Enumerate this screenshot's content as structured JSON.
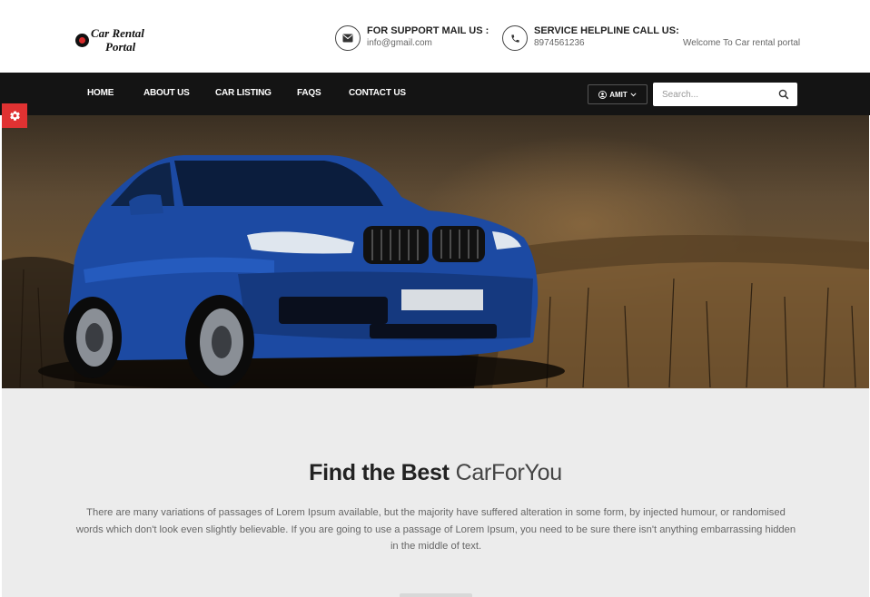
{
  "logo": {
    "line1": "Car Rental",
    "line2": "Portal"
  },
  "header": {
    "support_title": "FOR SUPPORT MAIL US :",
    "support_email": "info@gmail.com",
    "helpline_title": "SERVICE HELPLINE CALL US:",
    "helpline_phone": "8974561236",
    "welcome": "Welcome To Car rental portal"
  },
  "nav": {
    "items": [
      {
        "label": "HOME"
      },
      {
        "label": "ABOUT US"
      },
      {
        "label": "CAR LISTING"
      },
      {
        "label": "FAQS"
      },
      {
        "label": "CONTACT US"
      }
    ],
    "user_label": "AMIT",
    "search_placeholder": "Search..."
  },
  "main": {
    "headline_bold": "Find the Best",
    "headline_light": "CarForYou",
    "description": "There are many variations of passages of Lorem Ipsum available, but the majority have suffered alteration in some form, by injected humour, or randomised words which don't look even slightly believable. If you are going to use a passage of Lorem Ipsum, you need to be sure there isn't anything embarrassing hidden in the middle of text."
  },
  "colors": {
    "nav_bg": "#141414",
    "accent": "#e03232",
    "content_bg": "#ececec"
  },
  "icons": [
    "envelope-icon",
    "phone-icon",
    "user-icon",
    "chevron-down-icon",
    "search-icon",
    "gear-icon"
  ]
}
